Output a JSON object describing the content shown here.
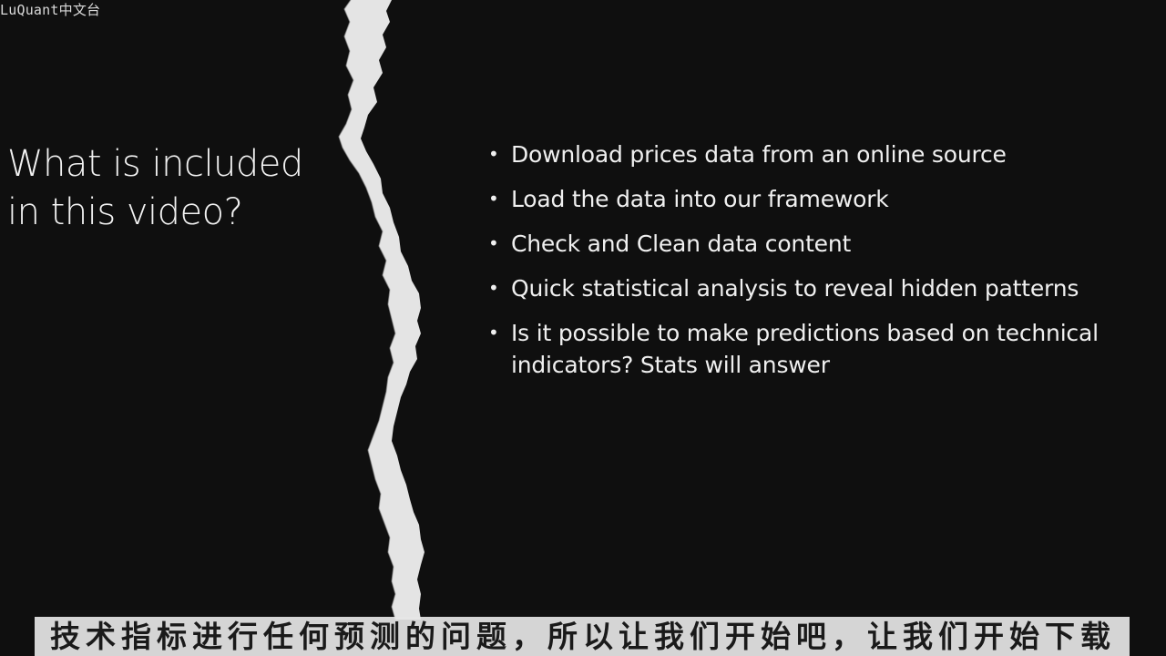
{
  "watermark": "LuQuant中文台",
  "slide": {
    "title_line1": "What is included",
    "title_line2": "in this video?",
    "bullet_symbol": "•",
    "bullets": [
      "Download prices data from an online source",
      "Load the data into our framework",
      "Check and Clean data content",
      "Quick statistical analysis to reveal hidden patterns",
      "Is it possible to make predictions based on technical indicators? Stats will answer"
    ]
  },
  "subtitle": "技术指标进行任何预测的问题，所以让我们开始吧，让我们开始下载",
  "colors": {
    "background": "#0f0f0f",
    "tear": "#e4e4e4",
    "text": "#f0f0f0",
    "subtitle_bg": "#e6e6e6"
  }
}
